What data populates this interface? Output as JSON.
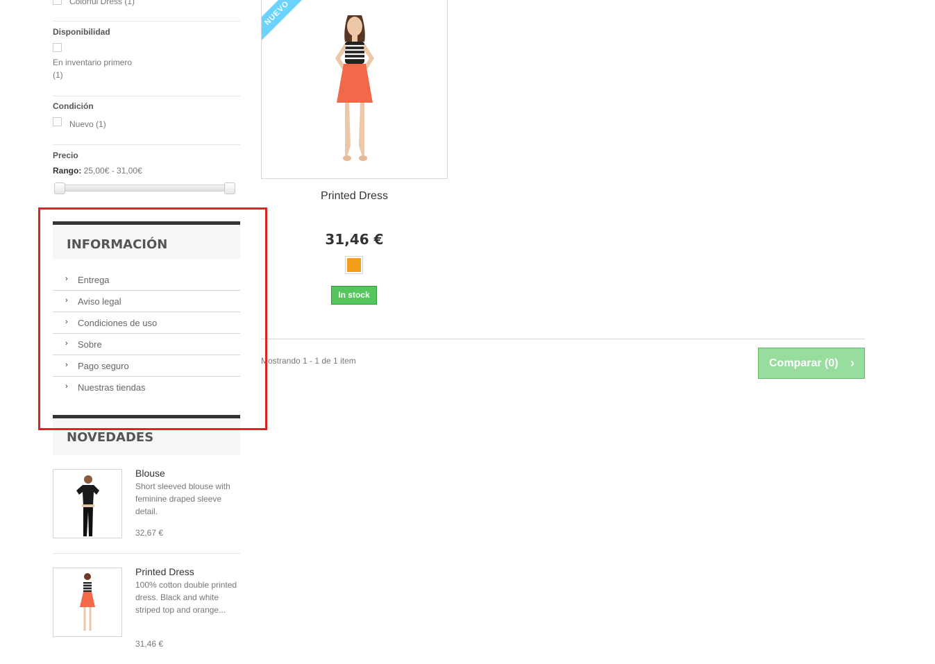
{
  "filters": {
    "prev_item": {
      "label": "Colorful Dress (1)"
    },
    "disponibilidad": {
      "title": "Disponibilidad",
      "option_label": "En inventario primero",
      "option_count": "(1)"
    },
    "condicion": {
      "title": "Condición",
      "option_label": "Nuevo (1)"
    },
    "precio": {
      "title": "Precio",
      "range_label": "Rango:",
      "range_value": "25,00€ - 31,00€",
      "range_min": 25.0,
      "range_max": 31.0
    }
  },
  "info_block": {
    "title": "INFORMACIÓN",
    "items": [
      {
        "label": "Entrega"
      },
      {
        "label": "Aviso legal"
      },
      {
        "label": "Condiciones de uso"
      },
      {
        "label": "Sobre"
      },
      {
        "label": "Pago seguro"
      },
      {
        "label": "Nuestras tiendas"
      }
    ]
  },
  "new_products": {
    "title": "NOVEDADES",
    "items": [
      {
        "name": "Blouse",
        "description": "Short sleeved blouse with feminine draped sleeve detail.",
        "price": "32,67 €"
      },
      {
        "name": "Printed Dress",
        "description": "100% cotton double printed dress. Black and white striped top and orange...",
        "price": "31,46 €"
      }
    ]
  },
  "product": {
    "badge": "NUEVO",
    "name": "Printed Dress",
    "price": "31,46 €",
    "swatch_color": "#f39d1b",
    "stock_label": "In stock"
  },
  "listing": {
    "showing": "Mostrando 1 - 1 de 1 item",
    "compare_label": "Comparar (0)"
  },
  "colors": {
    "highlight": "#e02128",
    "stock": "#55c65e",
    "compare": "#97dd9e",
    "ribbon": "#6ad4ff"
  }
}
